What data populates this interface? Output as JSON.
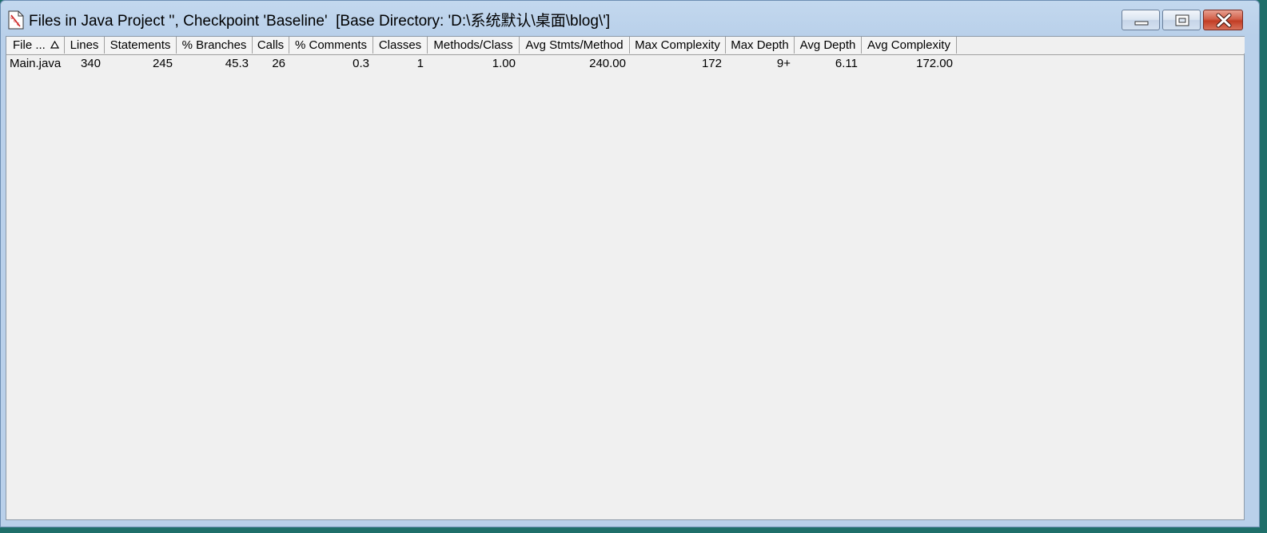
{
  "window": {
    "title": "Files in Java Project '', Checkpoint 'Baseline'  [Base Directory: 'D:\\系统默认\\桌面\\blog\\']",
    "controls": {
      "minimize": "minimize",
      "maximize": "maximize",
      "close": "close"
    }
  },
  "table": {
    "columns": [
      {
        "label": "File ...",
        "sorted": "ascending"
      },
      {
        "label": "Lines"
      },
      {
        "label": "Statements"
      },
      {
        "label": "% Branches"
      },
      {
        "label": "Calls"
      },
      {
        "label": "% Comments"
      },
      {
        "label": "Classes"
      },
      {
        "label": "Methods/Class"
      },
      {
        "label": "Avg Stmts/Method"
      },
      {
        "label": "Max Complexity"
      },
      {
        "label": "Max Depth"
      },
      {
        "label": "Avg Depth"
      },
      {
        "label": "Avg Complexity"
      }
    ],
    "rows": [
      [
        "Main.java",
        "340",
        "245",
        "45.3",
        "26",
        "0.3",
        "1",
        "1.00",
        "240.00",
        "172",
        "9+",
        "6.11",
        "172.00"
      ]
    ]
  },
  "icons": {
    "title_icon": "source-monitor-file-icon",
    "sort_icon": "sort-ascending-icon"
  }
}
